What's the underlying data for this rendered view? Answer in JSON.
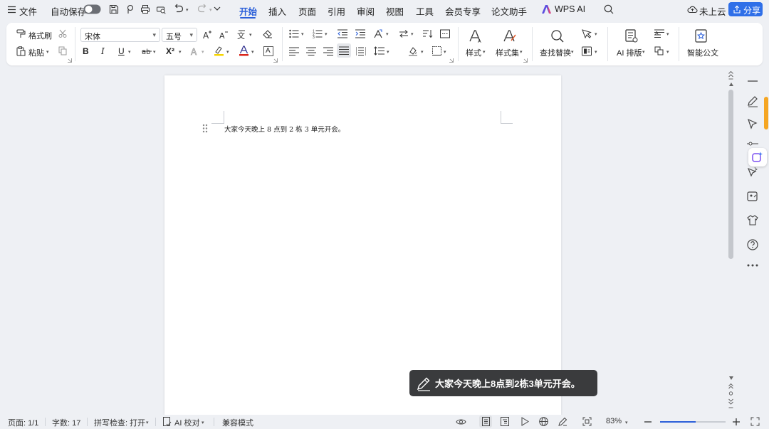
{
  "menubar": {
    "file": "文件",
    "autosave": "自动保存",
    "tabs": [
      "开始",
      "插入",
      "页面",
      "引用",
      "审阅",
      "视图",
      "工具",
      "会员专享",
      "论文助手"
    ],
    "active_tab": "开始",
    "wps_ai": "WPS AI",
    "cloud": "未上云",
    "share": "分享"
  },
  "ribbon": {
    "format_painter": "格式刷",
    "paste": "粘贴",
    "font_name": "宋体",
    "font_size": "五号",
    "style": "样式",
    "style_set": "样式集",
    "find_replace": "查找替换",
    "ai_layout": "AI 排版",
    "smart_doc": "智能公文",
    "bold": "B",
    "italic": "I",
    "underline": "U",
    "superscript": "X²",
    "font_color_glyph": "A",
    "accent_color": "#2b5fd9",
    "highlight_color": "#f5d400",
    "font_color": "#d9261c"
  },
  "document": {
    "text": "大家今天晚上 8 点到 2 栋 3 单元开会。"
  },
  "toast": {
    "text": "大家今天晚上8点到2栋3单元开会。"
  },
  "statusbar": {
    "page": "页面: 1/1",
    "word_count": "字数: 17",
    "spell_check": "拼写检查: 打开",
    "ai_proof": "AI 校对",
    "compat_mode": "兼容模式",
    "zoom": "83%"
  }
}
